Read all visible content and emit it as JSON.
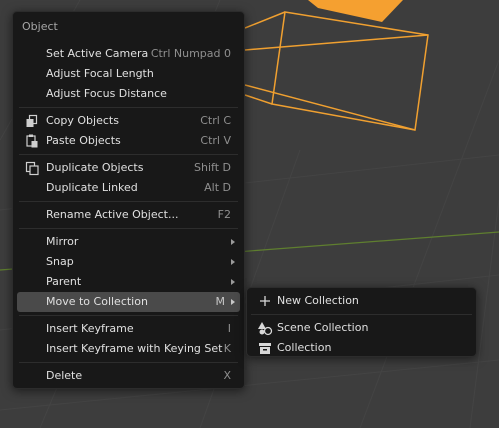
{
  "menu": {
    "title": "Object",
    "items": [
      {
        "label": "Set Active Camera",
        "shortcut": "Ctrl Numpad 0"
      },
      {
        "label": "Adjust Focal Length",
        "shortcut": ""
      },
      {
        "label": "Adjust Focus Distance",
        "shortcut": ""
      },
      {
        "label": "Copy Objects",
        "shortcut": "Ctrl C",
        "icon": "copy-icon"
      },
      {
        "label": "Paste Objects",
        "shortcut": "Ctrl V",
        "icon": "paste-icon"
      },
      {
        "label": "Duplicate Objects",
        "shortcut": "Shift D",
        "icon": "duplicate-icon"
      },
      {
        "label": "Duplicate Linked",
        "shortcut": "Alt D"
      },
      {
        "label": "Rename Active Object...",
        "shortcut": "F2"
      },
      {
        "label": "Mirror",
        "submenu": true
      },
      {
        "label": "Snap",
        "submenu": true
      },
      {
        "label": "Parent",
        "submenu": true
      },
      {
        "label": "Move to Collection",
        "shortcut": "M",
        "submenu": true,
        "highlighted": true
      },
      {
        "label": "Insert Keyframe",
        "shortcut": "I"
      },
      {
        "label": "Insert Keyframe with Keying Set",
        "shortcut": "K"
      },
      {
        "label": "Delete",
        "shortcut": "X"
      }
    ]
  },
  "submenu": {
    "items": [
      {
        "label": "New Collection",
        "icon": "plus-icon"
      },
      {
        "label": "Scene Collection",
        "icon": "scene-collection-icon"
      },
      {
        "label": "Collection",
        "icon": "collection-icon"
      }
    ]
  },
  "colors": {
    "viewport_bg": "#3d3d3d",
    "menu_bg": "#181818",
    "highlight": "#4a4a4a",
    "camera_orange": "#f5a030",
    "grid_line": "#444444",
    "axis_green": "#5f7f2f"
  }
}
